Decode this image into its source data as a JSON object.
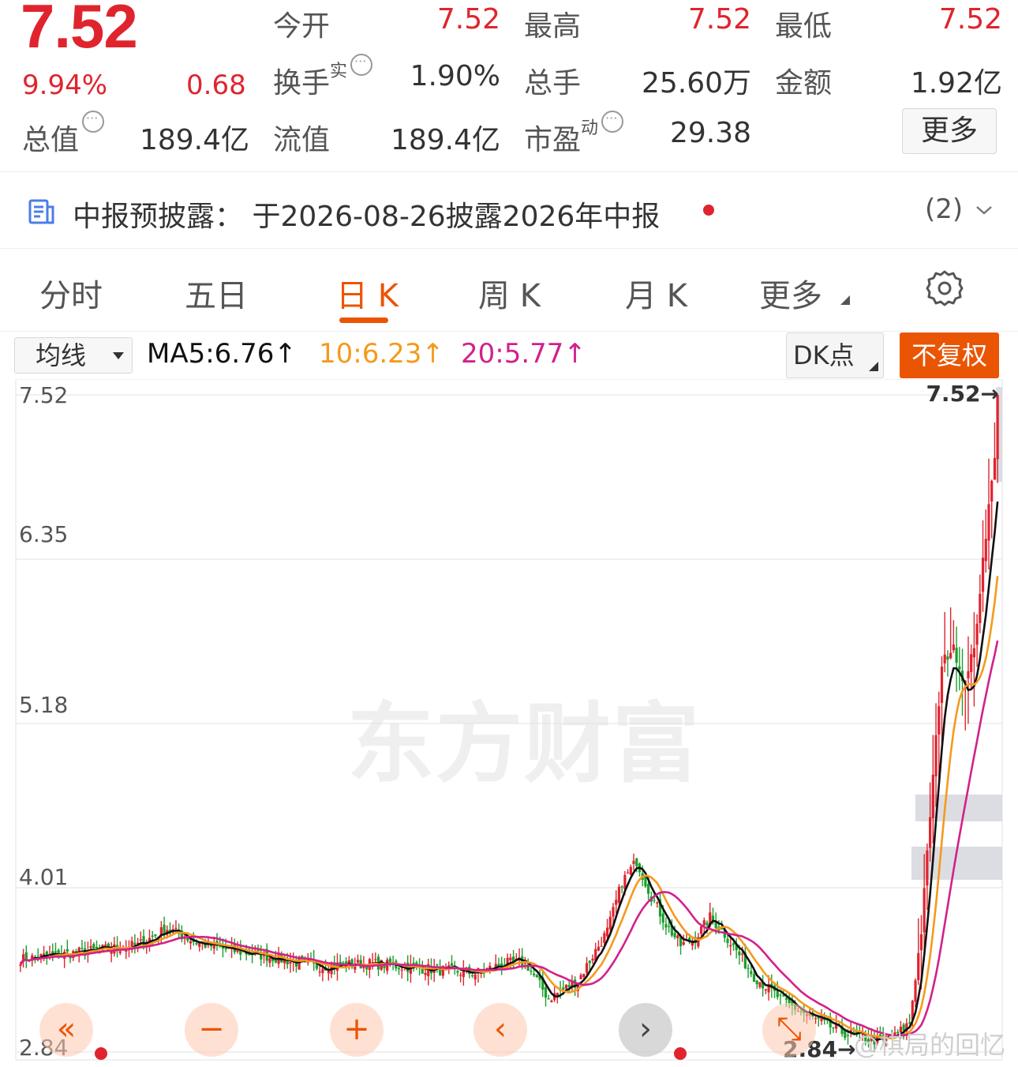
{
  "quote": {
    "price": "7.52",
    "change_pct": "9.94%",
    "change_amt": "0.68",
    "stats": [
      {
        "label": "今开",
        "value": "7.52"
      },
      {
        "label": "最高",
        "value": "7.52"
      },
      {
        "label": "最低",
        "value": "7.52"
      },
      {
        "label": "换手",
        "label_sup": "实",
        "value": "1.90%"
      },
      {
        "label": "总手",
        "value": "25.60万"
      },
      {
        "label": "金额",
        "value": "1.92亿"
      },
      {
        "label": "总值",
        "value": "189.4亿"
      },
      {
        "label": "流值",
        "value": "189.4亿"
      },
      {
        "label": "市盈",
        "label_sup": "动",
        "value": "29.38"
      }
    ],
    "more_button": "更多"
  },
  "notice": {
    "text": "中报预披露：  于2026-08-26披露2026年中报",
    "count": "(2)"
  },
  "tabs": [
    "分时",
    "五日",
    "日 K",
    "周 K",
    "月 K",
    "更多"
  ],
  "active_tab": 2,
  "ma_bar": {
    "select_label": "均线",
    "ma5": "MA5:6.76",
    "ma10": "10:6.23",
    "ma20": "20:5.77",
    "arrow": "↑",
    "dk_label": "DK点",
    "fq_label": "不复权"
  },
  "colors": {
    "up": "#e0242e",
    "down": "#1a9f2c",
    "accent": "#ea5504",
    "ma5": "#111111",
    "ma10": "#f59a1c",
    "ma20": "#d2218b"
  },
  "chart": {
    "watermark": "东方财富",
    "max_label": "7.52→",
    "min_label": "2.84→",
    "credit": "@棋局的回忆"
  },
  "chart_data": {
    "type": "candlestick",
    "y_ticks": [
      "7.52",
      "6.35",
      "5.18",
      "4.01",
      "2.84"
    ],
    "ylim": [
      2.84,
      7.52
    ],
    "max_price": 7.52,
    "min_price": 2.84,
    "last_close": 7.52,
    "series": [
      {
        "name": "MA5",
        "last": 6.76
      },
      {
        "name": "MA10",
        "last": 6.23
      },
      {
        "name": "MA20",
        "last": 5.77
      }
    ]
  },
  "controls": [
    {
      "name": "scroll-far-left",
      "glyph": "«"
    },
    {
      "name": "zoom-out",
      "glyph": "−"
    },
    {
      "name": "zoom-in",
      "glyph": "+"
    },
    {
      "name": "step-left",
      "glyph": "‹"
    },
    {
      "name": "step-right",
      "glyph": "›"
    },
    {
      "name": "reset",
      "glyph": "⤡"
    }
  ]
}
